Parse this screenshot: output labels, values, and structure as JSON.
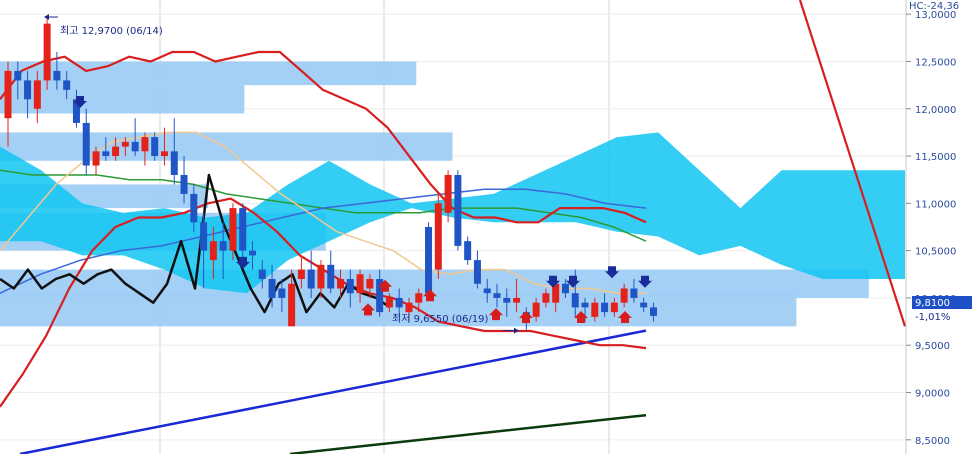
{
  "chart_data": {
    "type": "candlestick",
    "y_axis": {
      "side": "right",
      "ylim": [
        8.35,
        13.15
      ],
      "ticks": [
        "13,0000",
        "12,5000",
        "12,0000",
        "11,5000",
        "11,0000",
        "10,5000",
        "10,0000",
        "9,5000",
        "9,0000",
        "8,5000"
      ],
      "tick_values": [
        13.0,
        12.5,
        12.0,
        11.5,
        11.0,
        10.5,
        10.0,
        9.5,
        9.0,
        8.5
      ]
    },
    "header_label": "HC:-24,36",
    "current_price": {
      "value": 9.81,
      "label": "9,8100"
    },
    "change_label": "-1,01%",
    "annotations": {
      "high": {
        "label": "최고 12,9700 (06/14)",
        "value": 12.97
      },
      "low": {
        "label": "최저 9,6550 (06/19)",
        "value": 9.655
      }
    },
    "candles": [
      {
        "o": 11.9,
        "h": 12.5,
        "l": 11.6,
        "c": 12.4,
        "up": true
      },
      {
        "o": 12.4,
        "h": 12.5,
        "l": 12.1,
        "c": 12.3,
        "up": false
      },
      {
        "o": 12.3,
        "h": 12.4,
        "l": 11.9,
        "c": 12.1,
        "up": false
      },
      {
        "o": 12.0,
        "h": 12.4,
        "l": 11.85,
        "c": 12.3,
        "up": true
      },
      {
        "o": 12.3,
        "h": 12.97,
        "l": 12.2,
        "c": 12.9,
        "up": true
      },
      {
        "o": 12.4,
        "h": 12.6,
        "l": 12.2,
        "c": 12.3,
        "up": false
      },
      {
        "o": 12.3,
        "h": 12.4,
        "l": 12.1,
        "c": 12.2,
        "up": false
      },
      {
        "o": 12.1,
        "h": 12.2,
        "l": 11.8,
        "c": 11.85,
        "up": false
      },
      {
        "o": 11.85,
        "h": 12.0,
        "l": 11.3,
        "c": 11.4,
        "up": false
      },
      {
        "o": 11.4,
        "h": 11.6,
        "l": 11.3,
        "c": 11.55,
        "up": true
      },
      {
        "o": 11.55,
        "h": 11.7,
        "l": 11.45,
        "c": 11.5,
        "up": false
      },
      {
        "o": 11.5,
        "h": 11.7,
        "l": 11.45,
        "c": 11.6,
        "up": true
      },
      {
        "o": 11.6,
        "h": 11.7,
        "l": 11.5,
        "c": 11.65,
        "up": true
      },
      {
        "o": 11.65,
        "h": 11.9,
        "l": 11.5,
        "c": 11.55,
        "up": false
      },
      {
        "o": 11.55,
        "h": 11.75,
        "l": 11.4,
        "c": 11.7,
        "up": true
      },
      {
        "o": 11.7,
        "h": 11.75,
        "l": 11.45,
        "c": 11.5,
        "up": false
      },
      {
        "o": 11.5,
        "h": 11.8,
        "l": 11.4,
        "c": 11.55,
        "up": true
      },
      {
        "o": 11.55,
        "h": 11.9,
        "l": 11.2,
        "c": 11.3,
        "up": false
      },
      {
        "o": 11.3,
        "h": 11.5,
        "l": 11.0,
        "c": 11.1,
        "up": false
      },
      {
        "o": 11.1,
        "h": 11.2,
        "l": 10.7,
        "c": 10.8,
        "up": false
      },
      {
        "o": 10.8,
        "h": 10.9,
        "l": 10.1,
        "c": 10.5,
        "up": false
      },
      {
        "o": 10.4,
        "h": 10.75,
        "l": 10.2,
        "c": 10.6,
        "up": true
      },
      {
        "o": 10.6,
        "h": 10.8,
        "l": 10.2,
        "c": 10.5,
        "up": false
      },
      {
        "o": 10.5,
        "h": 11.0,
        "l": 10.4,
        "c": 10.95,
        "up": true
      },
      {
        "o": 10.95,
        "h": 11.0,
        "l": 10.4,
        "c": 10.5,
        "up": false
      },
      {
        "o": 10.5,
        "h": 10.6,
        "l": 10.3,
        "c": 10.45,
        "up": false
      },
      {
        "o": 10.3,
        "h": 10.4,
        "l": 10.1,
        "c": 10.2,
        "up": false
      },
      {
        "o": 10.2,
        "h": 10.35,
        "l": 9.9,
        "c": 10.0,
        "up": false
      },
      {
        "o": 10.0,
        "h": 10.2,
        "l": 9.85,
        "c": 10.1,
        "up": false
      },
      {
        "o": 9.7,
        "h": 10.3,
        "l": 9.7,
        "c": 10.15,
        "up": true
      },
      {
        "o": 10.2,
        "h": 10.45,
        "l": 10.1,
        "c": 10.3,
        "up": true
      },
      {
        "o": 10.3,
        "h": 10.5,
        "l": 10.0,
        "c": 10.1,
        "up": false
      },
      {
        "o": 10.1,
        "h": 10.4,
        "l": 10.0,
        "c": 10.35,
        "up": true
      },
      {
        "o": 10.35,
        "h": 10.5,
        "l": 10.05,
        "c": 10.1,
        "up": false
      },
      {
        "o": 10.1,
        "h": 10.3,
        "l": 10.0,
        "c": 10.2,
        "up": true
      },
      {
        "o": 10.2,
        "h": 10.3,
        "l": 9.9,
        "c": 10.05,
        "up": false
      },
      {
        "o": 10.05,
        "h": 10.3,
        "l": 9.95,
        "c": 10.25,
        "up": true
      },
      {
        "o": 10.1,
        "h": 10.25,
        "l": 10.0,
        "c": 10.2,
        "up": true
      },
      {
        "o": 10.2,
        "h": 10.3,
        "l": 9.8,
        "c": 9.85,
        "up": false
      },
      {
        "o": 9.9,
        "h": 10.05,
        "l": 9.85,
        "c": 10.0,
        "up": true
      },
      {
        "o": 10.0,
        "h": 10.1,
        "l": 9.8,
        "c": 9.9,
        "up": false
      },
      {
        "o": 9.85,
        "h": 10.0,
        "l": 9.75,
        "c": 9.95,
        "up": true
      },
      {
        "o": 9.95,
        "h": 10.1,
        "l": 9.85,
        "c": 10.05,
        "up": true
      },
      {
        "o": 10.05,
        "h": 10.8,
        "l": 10.0,
        "c": 10.75,
        "up": false
      },
      {
        "o": 10.3,
        "h": 11.1,
        "l": 10.2,
        "c": 11.0,
        "up": true
      },
      {
        "o": 10.9,
        "h": 11.35,
        "l": 10.8,
        "c": 11.3,
        "up": true
      },
      {
        "o": 11.3,
        "h": 11.35,
        "l": 10.5,
        "c": 10.55,
        "up": false
      },
      {
        "o": 10.6,
        "h": 10.65,
        "l": 10.35,
        "c": 10.4,
        "up": false
      },
      {
        "o": 10.4,
        "h": 10.5,
        "l": 10.1,
        "c": 10.15,
        "up": false
      },
      {
        "o": 10.1,
        "h": 10.2,
        "l": 9.95,
        "c": 10.05,
        "up": false
      },
      {
        "o": 10.05,
        "h": 10.15,
        "l": 9.9,
        "c": 10.0,
        "up": false
      },
      {
        "o": 10.0,
        "h": 10.1,
        "l": 9.8,
        "c": 9.95,
        "up": false
      },
      {
        "o": 9.95,
        "h": 10.2,
        "l": 9.85,
        "c": 10.0,
        "up": true
      },
      {
        "o": 9.75,
        "h": 9.9,
        "l": 9.655,
        "c": 9.85,
        "up": false
      },
      {
        "o": 9.8,
        "h": 10.0,
        "l": 9.75,
        "c": 9.95,
        "up": true
      },
      {
        "o": 9.95,
        "h": 10.1,
        "l": 9.9,
        "c": 10.05,
        "up": true
      },
      {
        "o": 9.95,
        "h": 10.15,
        "l": 9.85,
        "c": 10.15,
        "up": true
      },
      {
        "o": 10.15,
        "h": 10.2,
        "l": 10.0,
        "c": 10.05,
        "up": false
      },
      {
        "o": 10.05,
        "h": 10.3,
        "l": 9.8,
        "c": 9.9,
        "up": false
      },
      {
        "o": 9.9,
        "h": 10.0,
        "l": 9.75,
        "c": 9.95,
        "up": false
      },
      {
        "o": 9.8,
        "h": 10.0,
        "l": 9.75,
        "c": 9.95,
        "up": true
      },
      {
        "o": 9.95,
        "h": 10.05,
        "l": 9.8,
        "c": 9.85,
        "up": false
      },
      {
        "o": 9.85,
        "h": 10.0,
        "l": 9.8,
        "c": 9.95,
        "up": true
      },
      {
        "o": 9.95,
        "h": 10.15,
        "l": 9.9,
        "c": 10.1,
        "up": true
      },
      {
        "o": 10.1,
        "h": 10.2,
        "l": 9.95,
        "c": 10.0,
        "up": false
      },
      {
        "o": 9.95,
        "h": 10.0,
        "l": 9.85,
        "c": 9.9,
        "up": false
      },
      {
        "o": 9.9,
        "h": 9.95,
        "l": 9.75,
        "c": 9.81,
        "up": false
      }
    ],
    "volume_profile_zones": [
      {
        "lo": 12.25,
        "hi": 12.5,
        "x_end_fraction": 0.46
      },
      {
        "lo": 11.95,
        "hi": 12.25,
        "x_end_fraction": 0.27
      },
      {
        "lo": 11.45,
        "hi": 11.75,
        "x_end_fraction": 0.5
      },
      {
        "lo": 10.95,
        "hi": 11.2,
        "x_end_fraction": 0.23
      },
      {
        "lo": 10.5,
        "hi": 10.9,
        "x_end_fraction": 0.36
      },
      {
        "lo": 10.0,
        "hi": 10.3,
        "x_end_fraction": 0.96
      },
      {
        "lo": 9.7,
        "hi": 10.05,
        "x_end_fraction": 0.88
      }
    ],
    "cloud": {
      "top": [
        11.6,
        11.35,
        11.0,
        10.9,
        10.95,
        10.85,
        10.9,
        11.2,
        11.45,
        11.2,
        11.0,
        11.05,
        11.1,
        11.3,
        11.5,
        11.7,
        11.75,
        11.35,
        10.95,
        11.35,
        11.35,
        11.35,
        11.35
      ],
      "bottom": [
        10.6,
        10.6,
        10.45,
        10.45,
        10.3,
        10.1,
        10.05,
        10.4,
        10.6,
        10.8,
        10.95,
        10.85,
        10.8,
        10.8,
        10.8,
        10.7,
        10.65,
        10.45,
        10.55,
        10.35,
        10.2,
        10.2,
        10.2
      ]
    },
    "lines": {
      "bollinger_upper": [
        12.1,
        12.4,
        12.5,
        12.55,
        12.4,
        12.45,
        12.55,
        12.5,
        12.6,
        12.6,
        12.5,
        12.55,
        12.6,
        12.6,
        12.4,
        12.2,
        12.1,
        12.0,
        11.8,
        11.5,
        11.2,
        10.95,
        10.85,
        10.85,
        10.8,
        10.8,
        10.95,
        10.95,
        10.95,
        10.9,
        10.8
      ],
      "bollinger_lower": [
        8.85,
        9.2,
        9.6,
        10.1,
        10.5,
        10.75,
        10.85,
        10.85,
        10.9,
        11.0,
        11.05,
        10.9,
        10.7,
        10.45,
        10.3,
        10.15,
        10.05,
        10.0,
        9.9,
        9.75,
        9.7,
        9.65,
        9.65,
        9.65,
        9.6,
        9.55,
        9.5,
        9.5,
        9.47
      ],
      "ma_orange": [
        10.5,
        10.85,
        11.2,
        11.45,
        11.65,
        11.7,
        11.75,
        11.75,
        11.6,
        11.35,
        11.1,
        10.9,
        10.7,
        10.6,
        10.5,
        10.3,
        10.25,
        10.3,
        10.3,
        10.15,
        10.1,
        10.1,
        10.05,
        10.05
      ],
      "ma_green": [
        11.35,
        11.3,
        11.3,
        11.3,
        11.25,
        11.25,
        11.2,
        11.1,
        11.05,
        11.0,
        10.95,
        10.9,
        10.9,
        10.9,
        10.95,
        10.95,
        10.95,
        10.9,
        10.85,
        10.75,
        10.6
      ],
      "ma_blue": [
        10.05,
        10.25,
        10.4,
        10.5,
        10.55,
        10.65,
        10.75,
        10.85,
        10.95,
        11.0,
        11.05,
        11.1,
        11.15,
        11.15,
        11.1,
        11.0,
        10.95
      ],
      "trend_blue": [
        8.35,
        9.655
      ],
      "trend_dark_green": [
        8.35,
        8.76
      ],
      "red_diagonal": [
        13.15,
        9.7
      ],
      "black_oscillator": [
        10.2,
        10.1,
        10.3,
        10.1,
        10.2,
        10.25,
        10.15,
        10.25,
        10.3,
        10.15,
        10.05,
        9.95,
        10.15,
        10.6,
        10.1,
        11.3,
        10.8,
        10.45,
        10.1,
        9.85,
        10.15,
        10.25,
        9.85,
        10.05,
        9.9,
        10.15,
        10.05,
        10.0,
        9.9
      ]
    },
    "signal_arrows": [
      {
        "dir": "down",
        "color": "navy",
        "value": 12.05
      },
      {
        "dir": "down",
        "color": "navy",
        "value": 10.35
      },
      {
        "dir": "up",
        "color": "red",
        "value": 9.9
      },
      {
        "dir": "up",
        "color": "red",
        "value": 10.15
      },
      {
        "dir": "up",
        "color": "red",
        "value": 10.05
      },
      {
        "dir": "up",
        "color": "red",
        "value": 9.85
      },
      {
        "dir": "up",
        "color": "red",
        "value": 9.82
      },
      {
        "dir": "down",
        "color": "navy",
        "value": 10.15
      },
      {
        "dir": "down",
        "color": "navy",
        "value": 10.15
      },
      {
        "dir": "up",
        "color": "red",
        "value": 9.82
      },
      {
        "dir": "down",
        "color": "navy",
        "value": 10.25
      },
      {
        "dir": "up",
        "color": "red",
        "value": 9.82
      },
      {
        "dir": "down",
        "color": "navy",
        "value": 10.15
      }
    ],
    "grid": true,
    "colors": {
      "up": "#e3231b",
      "down": "#1f55c5",
      "zone": "#9fcdf6",
      "cloud": "#10c6f2",
      "boll": "#d81f1f",
      "ma_orange": "#f2c88f",
      "ma_green": "#2a9a36",
      "ma_blue": "#3b68d8",
      "trend_blue": "#1a29d6",
      "trend_green": "#0b3a0b",
      "osc": "#111111",
      "axis_text": "#2b4c9b",
      "tag_bg": "#1f4fc7"
    }
  }
}
